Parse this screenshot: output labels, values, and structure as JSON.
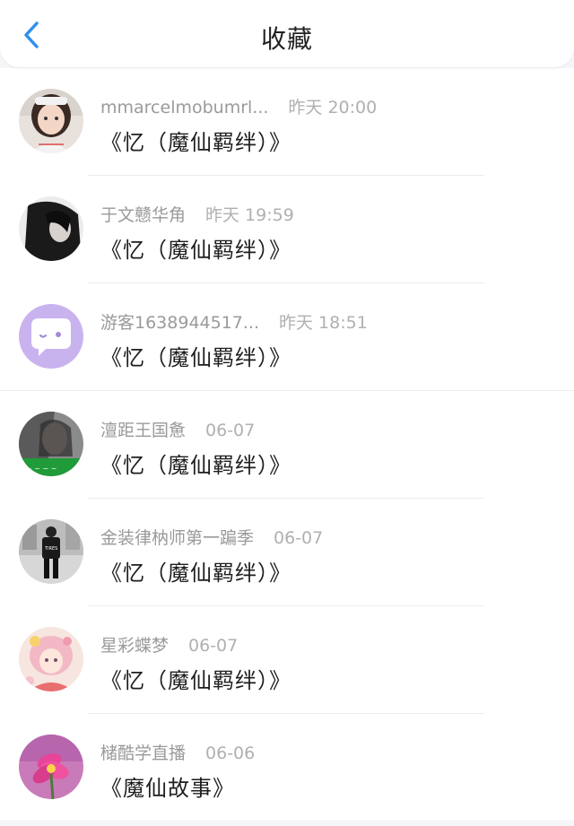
{
  "header": {
    "title": "收藏"
  },
  "items": [
    {
      "name": "mmarcelmobumrl...",
      "time": "昨天 20:00",
      "content": "《忆（魔仙羁绊）》",
      "avatar": "girl-avatar"
    },
    {
      "name": "于文戆华角",
      "time": "昨天 19:59",
      "content": "《忆（魔仙羁绊）》",
      "avatar": "dark-hair-avatar"
    },
    {
      "name": "游客1638944517...",
      "time": "昨天 18:51",
      "content": "《忆（魔仙羁绊）》",
      "avatar": "chat-bubble-avatar"
    },
    {
      "name": "澶距王国惫",
      "time": "06-07",
      "content": "《忆（魔仙羁绊）》",
      "avatar": "green-banner-avatar"
    },
    {
      "name": "金装律枘师第一蹁季",
      "time": "06-07",
      "content": "《忆（魔仙羁绊）》",
      "avatar": "street-figure-avatar"
    },
    {
      "name": "星彩蝶梦",
      "time": "06-07",
      "content": "《忆（魔仙羁绊）》",
      "avatar": "anime-girl-avatar"
    },
    {
      "name": "槠酷学直播",
      "time": "06-06",
      "content": "《魔仙故事》",
      "avatar": "pink-flower-avatar"
    }
  ],
  "colors": {
    "accent": "#2e8ff0",
    "background": "#f5f6f8"
  }
}
